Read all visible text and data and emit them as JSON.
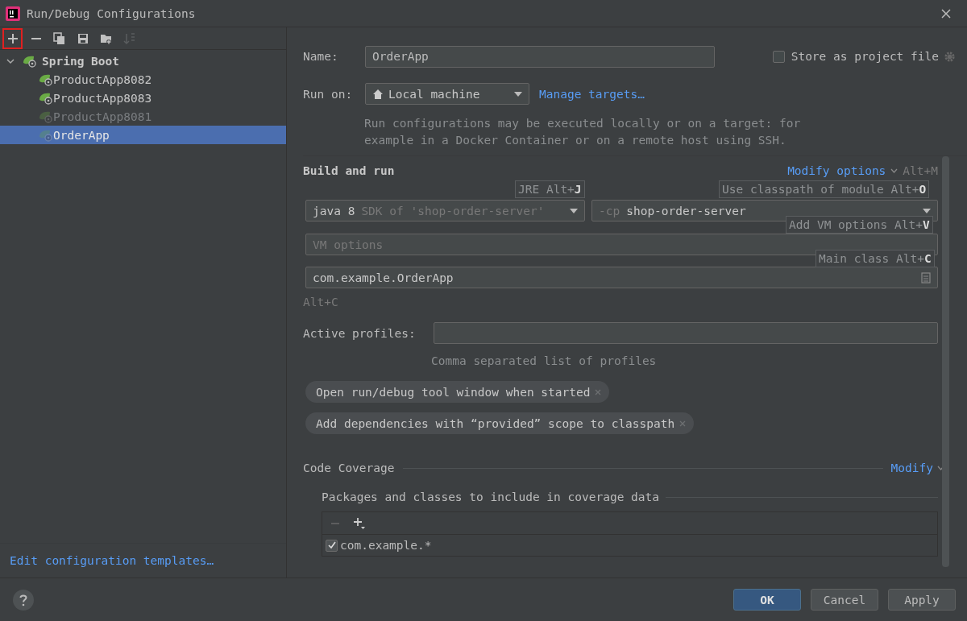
{
  "window": {
    "title": "Run/Debug Configurations"
  },
  "toolbar": [
    {
      "kind": "add",
      "highlighted": true,
      "disabled": false
    },
    {
      "kind": "remove",
      "highlighted": false,
      "disabled": false
    },
    {
      "kind": "copy",
      "highlighted": false,
      "disabled": false
    },
    {
      "kind": "save",
      "highlighted": false,
      "disabled": false
    },
    {
      "kind": "folder",
      "highlighted": false,
      "disabled": false
    },
    {
      "kind": "sort",
      "highlighted": false,
      "disabled": true
    }
  ],
  "tree": [
    {
      "label": "Spring Boot",
      "expanded": true,
      "children": [
        {
          "label": "ProductApp8082",
          "selected": false,
          "disabled": false
        },
        {
          "label": "ProductApp8083",
          "selected": false,
          "disabled": false
        },
        {
          "label": "ProductApp8081",
          "selected": false,
          "disabled": true
        },
        {
          "label": "OrderApp",
          "selected": true,
          "disabled": true
        }
      ]
    }
  ],
  "templates_link": "Edit configuration templates…",
  "name": {
    "label": "Name:",
    "value": "OrderApp"
  },
  "store_as_project_file": {
    "label": "Store as project file",
    "checked": false
  },
  "run_on": {
    "label": "Run on:",
    "value": "Local machine",
    "link": "Manage targets…",
    "hint": "Run configurations may be executed locally or on a target: for\nexample in a Docker Container or on a remote host using SSH."
  },
  "build_and_run": {
    "title": "Build and run",
    "modify_link": "Modify options",
    "modify_shortcut": "Alt+M",
    "jre": {
      "value": "java 8",
      "hint": "SDK of 'shop-order-server'"
    },
    "classpath": {
      "prefix": "-cp",
      "value": "shop-order-server"
    },
    "vm_options": {
      "placeholder": "VM options"
    },
    "main_class": {
      "value": "com.example.OrderApp"
    },
    "shortcut_hint": "Alt+C"
  },
  "tooltips": [
    {
      "text": "JRE Alt+**J**"
    },
    {
      "text": "Use classpath of module Alt+**O**"
    },
    {
      "text": "Add VM options Alt+**V**"
    },
    {
      "text": "Main class Alt+**C**"
    }
  ],
  "active_profiles": {
    "label": "Active profiles:",
    "hint": "Comma separated list of profiles"
  },
  "option_tags": [
    "Open run/debug tool window when started",
    "Add dependencies with “provided” scope to classpath"
  ],
  "code_coverage": {
    "title": "Code Coverage",
    "modify_link": "Modify",
    "packages_title": "Packages and classes to include in coverage data",
    "patterns": [
      {
        "label": "com.example.*",
        "checked": true
      }
    ]
  },
  "buttons": [
    {
      "label": "OK",
      "default": true
    },
    {
      "label": "Cancel",
      "default": false
    },
    {
      "label": "Apply",
      "default": false
    }
  ]
}
